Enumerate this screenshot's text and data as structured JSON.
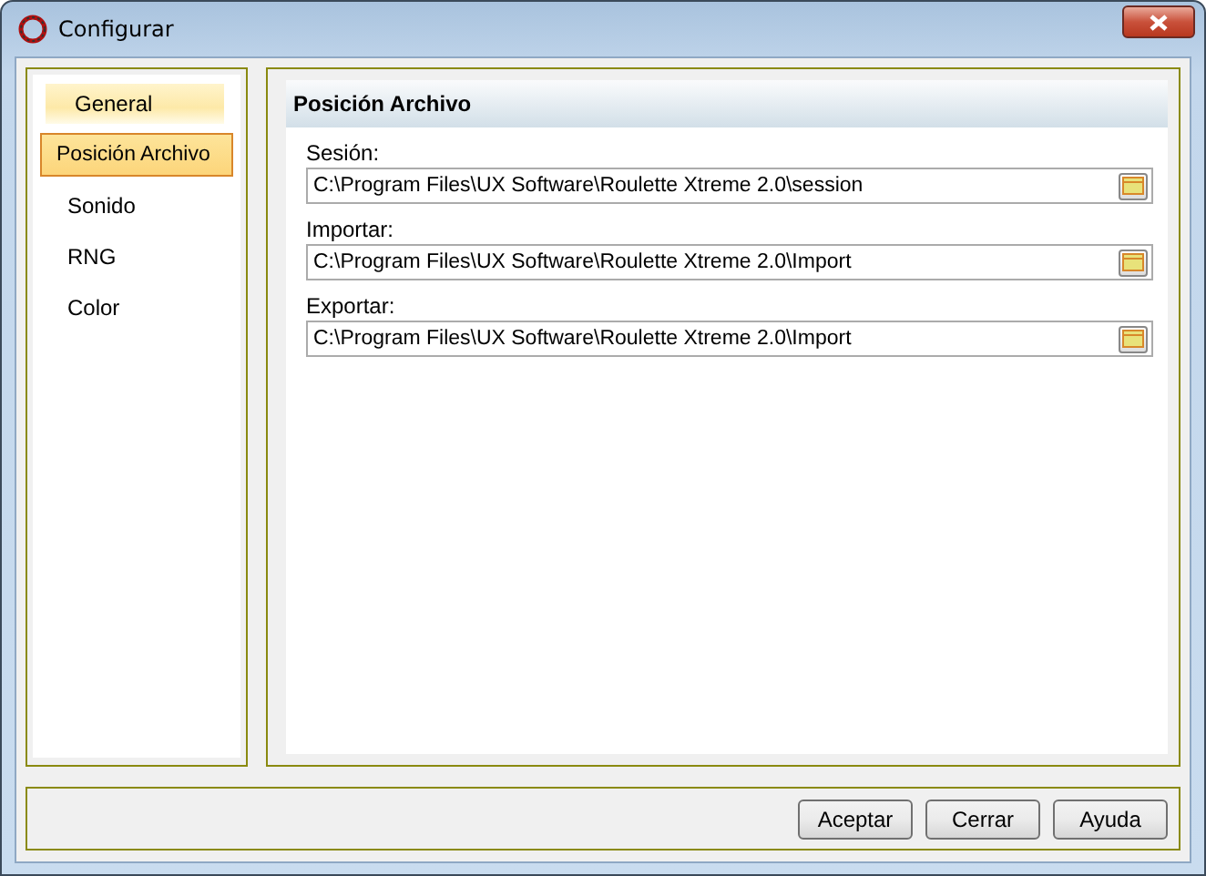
{
  "window": {
    "title": "Configurar"
  },
  "sidebar": {
    "items": [
      {
        "label": "General",
        "selected": false,
        "hover": true
      },
      {
        "label": "Posición Archivo",
        "selected": true,
        "hover": false
      },
      {
        "label": "Sonido",
        "selected": false,
        "hover": false
      },
      {
        "label": "RNG",
        "selected": false,
        "hover": false
      },
      {
        "label": "Color",
        "selected": false,
        "hover": false
      }
    ]
  },
  "panel": {
    "title": "Posición Archivo",
    "fields": [
      {
        "label": "Sesión:",
        "value": "C:\\Program Files\\UX Software\\Roulette Xtreme 2.0\\session"
      },
      {
        "label": "Importar:",
        "value": "C:\\Program Files\\UX Software\\Roulette Xtreme 2.0\\Import"
      },
      {
        "label": "Exportar:",
        "value": "C:\\Program Files\\UX Software\\Roulette Xtreme 2.0\\Import"
      }
    ]
  },
  "buttons": [
    "Aceptar",
    "Cerrar",
    "Ayuda"
  ]
}
